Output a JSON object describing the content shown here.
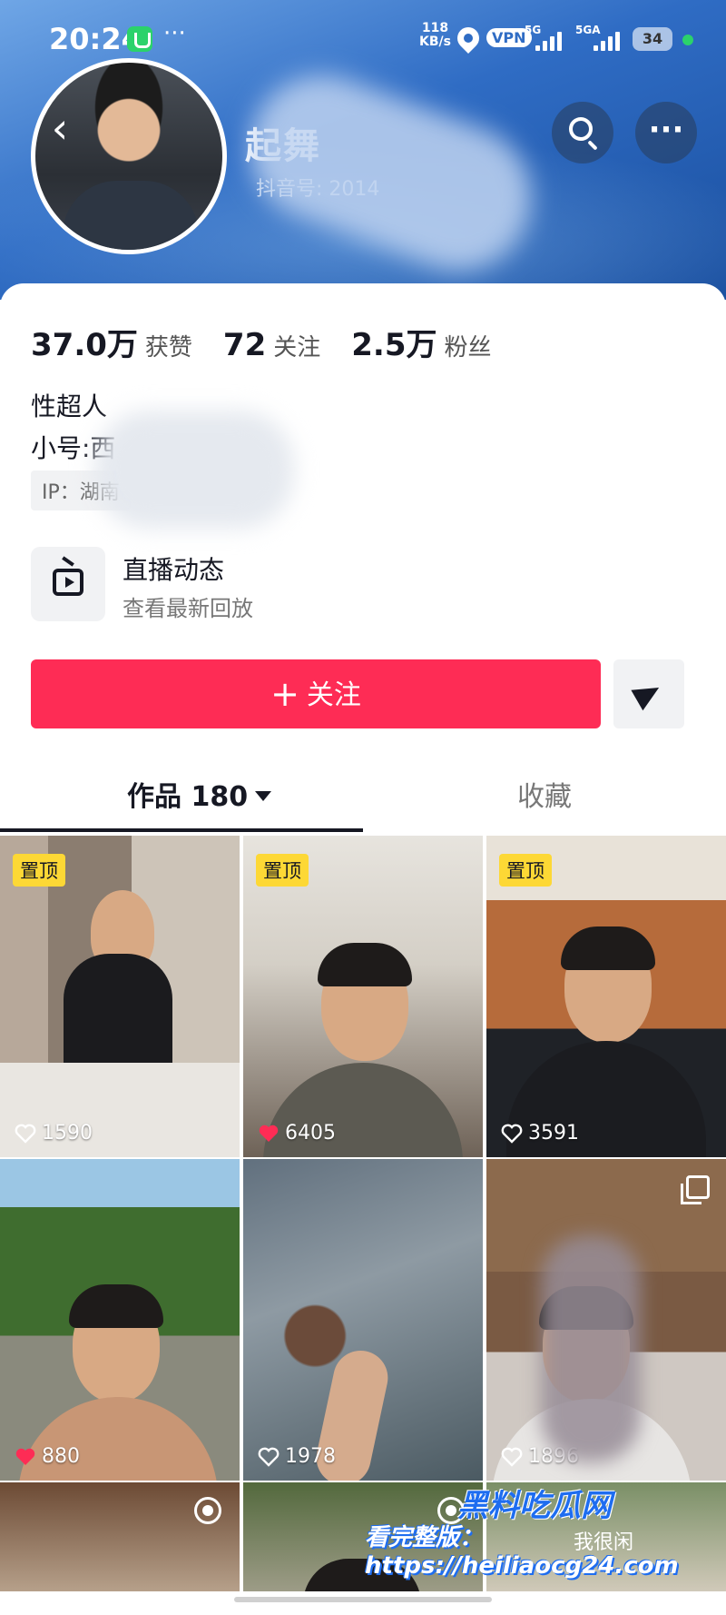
{
  "status_bar": {
    "time": "20:24",
    "dots": "···",
    "net_speed_value": "118",
    "net_speed_unit": "KB/s",
    "vpn": "VPN",
    "signal1": "5G",
    "signal2": "5GA",
    "battery": "34"
  },
  "profile": {
    "back_icon": "chevron-left-icon",
    "nickname": "起舞",
    "douyin_id": "抖音号: 2014",
    "search_icon": "search-icon",
    "more_icon": "more-icon",
    "more_glyph": "···"
  },
  "stats": [
    {
      "value": "37.0万",
      "label": "获赞"
    },
    {
      "value": "72",
      "label": "关注"
    },
    {
      "value": "2.5万",
      "label": "粉丝"
    }
  ],
  "bio": {
    "line1": "性超人",
    "line2": "小号:西",
    "ip": "IP：湖南"
  },
  "live": {
    "title": "直播动态",
    "subtitle": "查看最新回放"
  },
  "actions": {
    "follow_plus": "+",
    "follow_label": "关注"
  },
  "tabs": {
    "works_label": "作品 180",
    "favorites_label": "收藏"
  },
  "videos": [
    {
      "pinned": true,
      "pin_label": "置顶",
      "likes": "1590",
      "liked": false
    },
    {
      "pinned": true,
      "pin_label": "置顶",
      "likes": "6405",
      "liked": true
    },
    {
      "pinned": true,
      "pin_label": "置顶",
      "likes": "3591",
      "liked": false
    },
    {
      "pinned": false,
      "likes": "880",
      "liked": true
    },
    {
      "pinned": false,
      "likes": "1978",
      "liked": false
    },
    {
      "pinned": false,
      "likes": "1896",
      "liked": false
    }
  ],
  "partial_tile_text": "我很闲",
  "watermark": {
    "brand": "黑料吃瓜网",
    "url": "看完整版：https://heiliaocg24.com"
  },
  "colors": {
    "accent": "#fe2c55",
    "pin_yellow": "#fdd835",
    "header_blue": "#2f6cc4"
  }
}
